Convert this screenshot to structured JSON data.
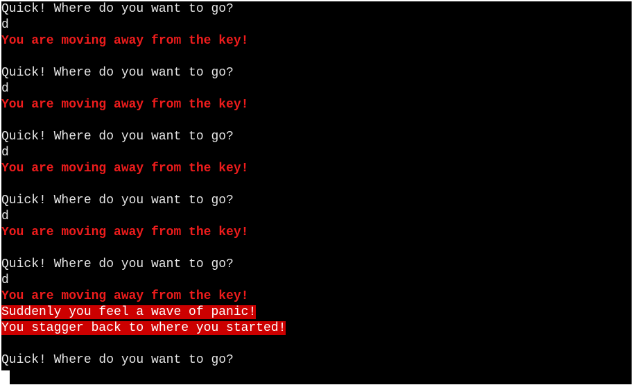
{
  "terminal": {
    "lines": [
      {
        "kind": "prompt",
        "text": "Quick! Where do you want to go?"
      },
      {
        "kind": "input",
        "text": "d"
      },
      {
        "kind": "warn",
        "text": "You are moving away from the key!"
      },
      {
        "kind": "blank",
        "text": ""
      },
      {
        "kind": "prompt",
        "text": "Quick! Where do you want to go?"
      },
      {
        "kind": "input",
        "text": "d"
      },
      {
        "kind": "warn",
        "text": "You are moving away from the key!"
      },
      {
        "kind": "blank",
        "text": ""
      },
      {
        "kind": "prompt",
        "text": "Quick! Where do you want to go?"
      },
      {
        "kind": "input",
        "text": "d"
      },
      {
        "kind": "warn",
        "text": "You are moving away from the key!"
      },
      {
        "kind": "blank",
        "text": ""
      },
      {
        "kind": "prompt",
        "text": "Quick! Where do you want to go?"
      },
      {
        "kind": "input",
        "text": "d"
      },
      {
        "kind": "warn",
        "text": "You are moving away from the key!"
      },
      {
        "kind": "blank",
        "text": ""
      },
      {
        "kind": "prompt",
        "text": "Quick! Where do you want to go?"
      },
      {
        "kind": "input",
        "text": "d"
      },
      {
        "kind": "warn",
        "text": "You are moving away from the key!"
      },
      {
        "kind": "alert",
        "text": "Suddenly you feel a wave of panic!"
      },
      {
        "kind": "alert",
        "text": "You stagger back to where you started!"
      },
      {
        "kind": "blank",
        "text": ""
      },
      {
        "kind": "prompt",
        "text": "Quick! Where do you want to go?"
      }
    ],
    "colors": {
      "background": "#000000",
      "text": "#e6e6e6",
      "warning_text": "#ee1c1c",
      "alert_background": "#cc0000",
      "alert_text": "#ffffff",
      "cursor": "#ffffff"
    }
  }
}
